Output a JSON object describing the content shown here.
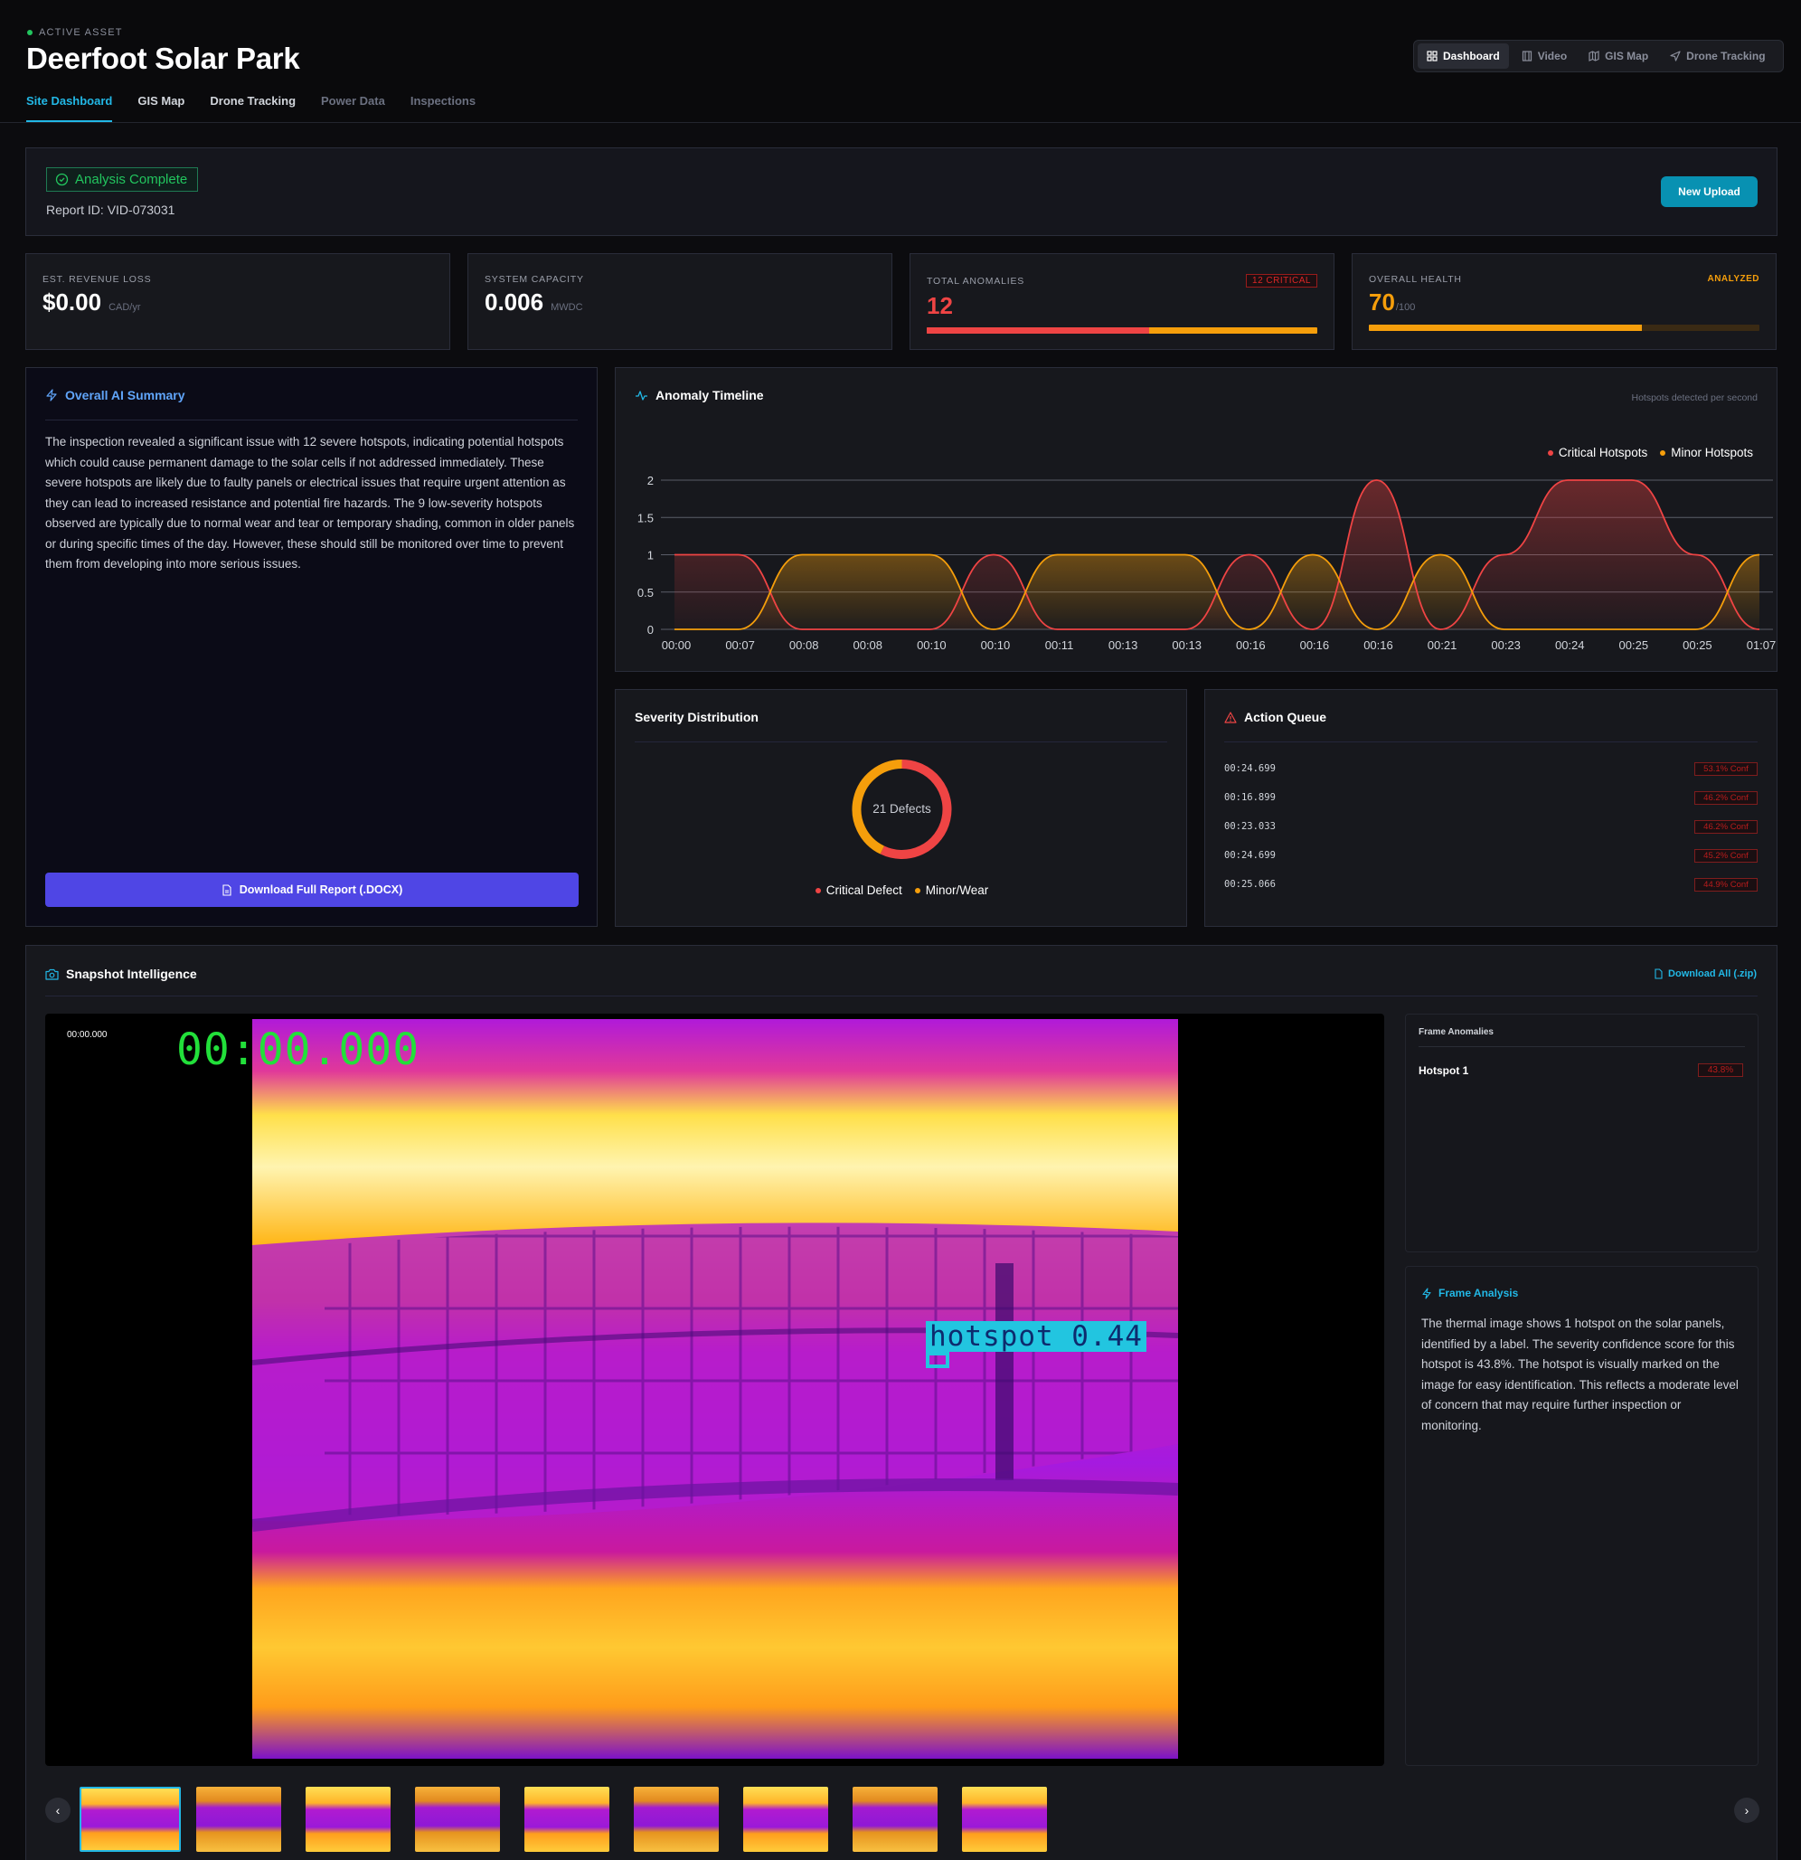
{
  "header": {
    "eyebrow": "ACTIVE ASSET",
    "title": "Deerfoot Solar Park",
    "tabs": [
      "Site Dashboard",
      "GIS Map",
      "Drone Tracking",
      "Power Data",
      "Inspections"
    ],
    "view_switch": [
      "Dashboard",
      "Video",
      "GIS Map",
      "Drone Tracking"
    ]
  },
  "status": {
    "badge": "Analysis Complete",
    "report_id": "Report ID: VID-073031",
    "new_upload": "New Upload"
  },
  "kpis": {
    "revenue": {
      "label": "EST. REVENUE LOSS",
      "value": "$0.00",
      "unit": "CAD/yr"
    },
    "capacity": {
      "label": "SYSTEM CAPACITY",
      "value": "0.006",
      "unit": "MWDC"
    },
    "anomalies": {
      "label": "TOTAL ANOMALIES",
      "value": "12",
      "badge": "12 CRITICAL",
      "bar_critical_fraction": 0.57
    },
    "health": {
      "label": "OVERALL HEALTH",
      "value": "70",
      "unit": "/100",
      "badge": "ANALYZED",
      "bar_fraction": 0.7
    }
  },
  "summary": {
    "title": "Overall AI Summary",
    "text": "The inspection revealed a significant issue with 12 severe hotspots, indicating potential hotspots which could cause permanent damage to the solar cells if not addressed immediately. These severe hotspots are likely due to faulty panels or electrical issues that require urgent attention as they can lead to increased resistance and potential fire hazards. The 9 low-severity hotspots observed are typically due to normal wear and tear or temporary shading, common in older panels or during specific times of the day. However, these should still be monitored over time to prevent them from developing into more serious issues.",
    "download": "Download Full Report (.DOCX)"
  },
  "timeline": {
    "title": "Anomaly Timeline",
    "hint": "Hotspots detected per second"
  },
  "severity": {
    "title": "Severity Distribution",
    "center_label": "21 Defects",
    "legend": [
      "Critical Defect",
      "Minor/Wear"
    ]
  },
  "queue": {
    "title": "Action Queue",
    "items": [
      {
        "time": "00:24.699",
        "conf": "53.1% Conf"
      },
      {
        "time": "00:16.899",
        "conf": "46.2% Conf"
      },
      {
        "time": "00:23.033",
        "conf": "46.2% Conf"
      },
      {
        "time": "00:24.699",
        "conf": "45.2% Conf"
      },
      {
        "time": "00:25.066",
        "conf": "44.9% Conf"
      }
    ]
  },
  "snapshot": {
    "title": "Snapshot Intelligence",
    "download_all": "Download All (.zip)",
    "viewer_time": "00:00.000",
    "overlay_time": "00:00.000",
    "detection_label": "hotspot 0.44",
    "frame_anomalies_title": "Frame Anomalies",
    "anomaly_name": "Hotspot 1",
    "anomaly_conf": "43.8%",
    "analysis_title": "Frame Analysis",
    "analysis_text": "The thermal image shows 1 hotspot on the solar panels, identified by a label. The severity confidence score for this hotspot is 43.8%. The hotspot is visually marked on the image for easy identification. This reflects a moderate level of concern that may require further inspection or monitoring.",
    "thumbnail_count": 9
  },
  "colors": {
    "critical": "#ef4444",
    "minor": "#f59e0b",
    "accent": "#22b8e6",
    "success": "#22c55e",
    "primary_button": "#4f46e5"
  },
  "chart_data": [
    {
      "type": "line",
      "title": "Anomaly Timeline",
      "subtitle": "Hotspots detected per second",
      "categories": [
        "00:00",
        "00:07",
        "00:08",
        "00:08",
        "00:10",
        "00:10",
        "00:11",
        "00:13",
        "00:13",
        "00:16",
        "00:16",
        "00:16",
        "00:21",
        "00:23",
        "00:24",
        "00:25",
        "00:25",
        "01:07"
      ],
      "series": [
        {
          "name": "Critical Hotspots",
          "values": [
            1,
            1,
            0,
            0,
            0,
            1,
            0,
            0,
            0,
            1,
            0,
            2,
            0,
            1,
            2,
            2,
            1,
            0
          ]
        },
        {
          "name": "Minor Hotspots",
          "values": [
            0,
            0,
            1,
            1,
            1,
            0,
            1,
            1,
            1,
            0,
            1,
            0,
            1,
            0,
            0,
            0,
            0,
            1
          ]
        }
      ],
      "y_ticks": [
        "0",
        "0.5",
        "1",
        "1.5",
        "2"
      ],
      "ylim": [
        0,
        2
      ],
      "grid": true,
      "legend": "top-right"
    },
    {
      "type": "pie",
      "title": "Severity Distribution",
      "center_label": "21 Defects",
      "categories": [
        "Critical Defect",
        "Minor/Wear"
      ],
      "values": [
        12,
        9
      ]
    }
  ]
}
